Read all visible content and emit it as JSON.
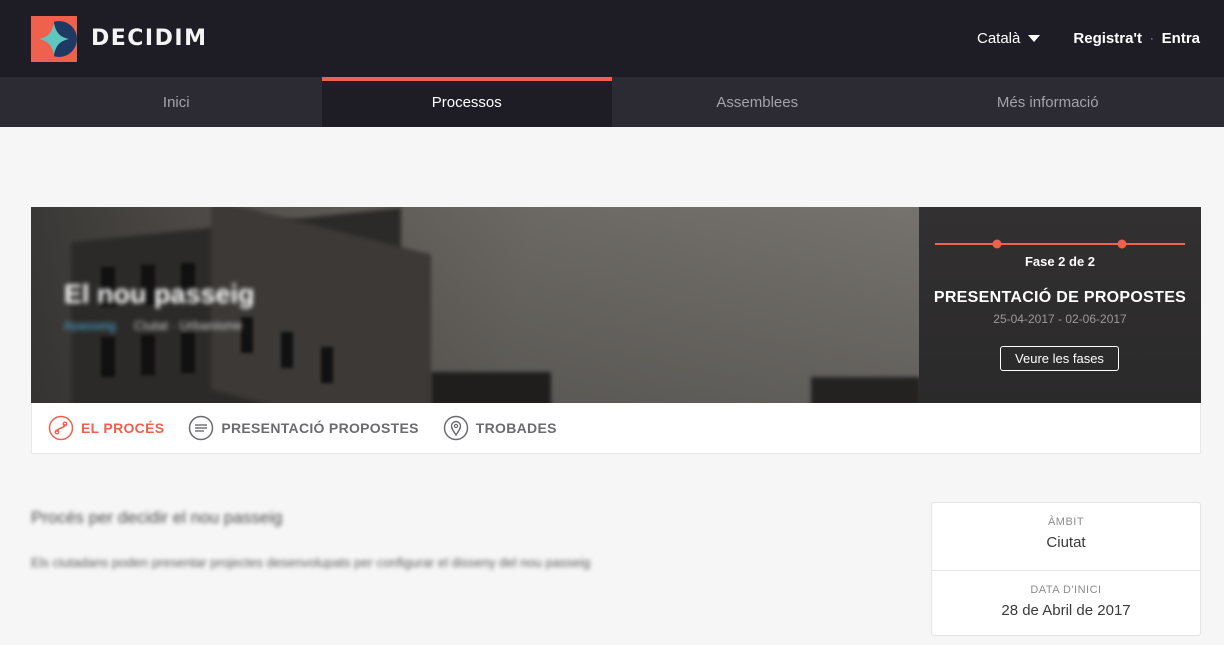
{
  "header": {
    "brand": "DECIDIM",
    "language": "Català",
    "register": "Registra't",
    "separator": "·",
    "login": "Entra"
  },
  "nav": {
    "items": [
      {
        "label": "Inici"
      },
      {
        "label": "Processos"
      },
      {
        "label": "Assemblees"
      },
      {
        "label": "Més informació"
      }
    ],
    "active": "Processos"
  },
  "hero": {
    "title": "El nou passeig",
    "hashtag": "#passeig",
    "scope": "Ciutat · Urbanisme"
  },
  "phase": {
    "label": "Fase 2 de 2",
    "name": "PRESENTACIÓ DE PROPOSTES",
    "dates": "25-04-2017 - 02-06-2017",
    "button": "Veure les fases"
  },
  "tabs": {
    "process": "EL PROCÉS",
    "proposals": "PRESENTACIÓ PROPOSTES",
    "meetings": "TROBADES"
  },
  "content": {
    "title": "Procés per decidir el nou passeig",
    "description": "Els ciutadans poden presentar projectes desenvolupats per configurar el disseny del nou passeig"
  },
  "info_card": {
    "scope_label": "ÀMBIT",
    "scope_value": "Ciutat",
    "start_label": "DATA D'INICI",
    "start_value": "28 de Abril de 2017"
  },
  "colors": {
    "accent": "#ef604d",
    "header_bg": "#1e1c25",
    "nav_bg": "#2c2a33"
  }
}
